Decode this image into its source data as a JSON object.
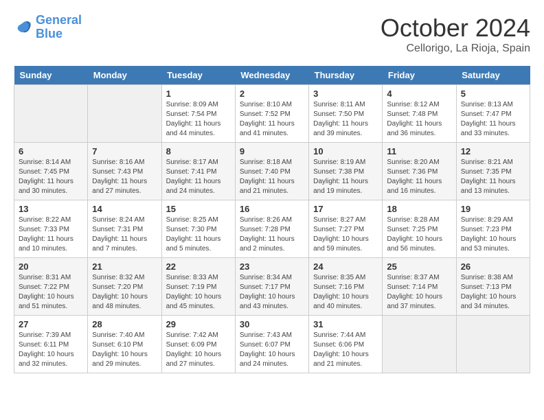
{
  "header": {
    "logo_line1": "General",
    "logo_line2": "Blue",
    "month_title": "October 2024",
    "location": "Cellorigo, La Rioja, Spain"
  },
  "weekdays": [
    "Sunday",
    "Monday",
    "Tuesday",
    "Wednesday",
    "Thursday",
    "Friday",
    "Saturday"
  ],
  "weeks": [
    [
      {
        "day": "",
        "empty": true
      },
      {
        "day": "",
        "empty": true
      },
      {
        "day": "1",
        "sunrise": "8:09 AM",
        "sunset": "7:54 PM",
        "daylight": "11 hours and 44 minutes."
      },
      {
        "day": "2",
        "sunrise": "8:10 AM",
        "sunset": "7:52 PM",
        "daylight": "11 hours and 41 minutes."
      },
      {
        "day": "3",
        "sunrise": "8:11 AM",
        "sunset": "7:50 PM",
        "daylight": "11 hours and 39 minutes."
      },
      {
        "day": "4",
        "sunrise": "8:12 AM",
        "sunset": "7:48 PM",
        "daylight": "11 hours and 36 minutes."
      },
      {
        "day": "5",
        "sunrise": "8:13 AM",
        "sunset": "7:47 PM",
        "daylight": "11 hours and 33 minutes."
      }
    ],
    [
      {
        "day": "6",
        "sunrise": "8:14 AM",
        "sunset": "7:45 PM",
        "daylight": "11 hours and 30 minutes."
      },
      {
        "day": "7",
        "sunrise": "8:16 AM",
        "sunset": "7:43 PM",
        "daylight": "11 hours and 27 minutes."
      },
      {
        "day": "8",
        "sunrise": "8:17 AM",
        "sunset": "7:41 PM",
        "daylight": "11 hours and 24 minutes."
      },
      {
        "day": "9",
        "sunrise": "8:18 AM",
        "sunset": "7:40 PM",
        "daylight": "11 hours and 21 minutes."
      },
      {
        "day": "10",
        "sunrise": "8:19 AM",
        "sunset": "7:38 PM",
        "daylight": "11 hours and 19 minutes."
      },
      {
        "day": "11",
        "sunrise": "8:20 AM",
        "sunset": "7:36 PM",
        "daylight": "11 hours and 16 minutes."
      },
      {
        "day": "12",
        "sunrise": "8:21 AM",
        "sunset": "7:35 PM",
        "daylight": "11 hours and 13 minutes."
      }
    ],
    [
      {
        "day": "13",
        "sunrise": "8:22 AM",
        "sunset": "7:33 PM",
        "daylight": "11 hours and 10 minutes."
      },
      {
        "day": "14",
        "sunrise": "8:24 AM",
        "sunset": "7:31 PM",
        "daylight": "11 hours and 7 minutes."
      },
      {
        "day": "15",
        "sunrise": "8:25 AM",
        "sunset": "7:30 PM",
        "daylight": "11 hours and 5 minutes."
      },
      {
        "day": "16",
        "sunrise": "8:26 AM",
        "sunset": "7:28 PM",
        "daylight": "11 hours and 2 minutes."
      },
      {
        "day": "17",
        "sunrise": "8:27 AM",
        "sunset": "7:27 PM",
        "daylight": "10 hours and 59 minutes."
      },
      {
        "day": "18",
        "sunrise": "8:28 AM",
        "sunset": "7:25 PM",
        "daylight": "10 hours and 56 minutes."
      },
      {
        "day": "19",
        "sunrise": "8:29 AM",
        "sunset": "7:23 PM",
        "daylight": "10 hours and 53 minutes."
      }
    ],
    [
      {
        "day": "20",
        "sunrise": "8:31 AM",
        "sunset": "7:22 PM",
        "daylight": "10 hours and 51 minutes."
      },
      {
        "day": "21",
        "sunrise": "8:32 AM",
        "sunset": "7:20 PM",
        "daylight": "10 hours and 48 minutes."
      },
      {
        "day": "22",
        "sunrise": "8:33 AM",
        "sunset": "7:19 PM",
        "daylight": "10 hours and 45 minutes."
      },
      {
        "day": "23",
        "sunrise": "8:34 AM",
        "sunset": "7:17 PM",
        "daylight": "10 hours and 43 minutes."
      },
      {
        "day": "24",
        "sunrise": "8:35 AM",
        "sunset": "7:16 PM",
        "daylight": "10 hours and 40 minutes."
      },
      {
        "day": "25",
        "sunrise": "8:37 AM",
        "sunset": "7:14 PM",
        "daylight": "10 hours and 37 minutes."
      },
      {
        "day": "26",
        "sunrise": "8:38 AM",
        "sunset": "7:13 PM",
        "daylight": "10 hours and 34 minutes."
      }
    ],
    [
      {
        "day": "27",
        "sunrise": "7:39 AM",
        "sunset": "6:11 PM",
        "daylight": "10 hours and 32 minutes."
      },
      {
        "day": "28",
        "sunrise": "7:40 AM",
        "sunset": "6:10 PM",
        "daylight": "10 hours and 29 minutes."
      },
      {
        "day": "29",
        "sunrise": "7:42 AM",
        "sunset": "6:09 PM",
        "daylight": "10 hours and 27 minutes."
      },
      {
        "day": "30",
        "sunrise": "7:43 AM",
        "sunset": "6:07 PM",
        "daylight": "10 hours and 24 minutes."
      },
      {
        "day": "31",
        "sunrise": "7:44 AM",
        "sunset": "6:06 PM",
        "daylight": "10 hours and 21 minutes."
      },
      {
        "day": "",
        "empty": true
      },
      {
        "day": "",
        "empty": true
      }
    ]
  ]
}
